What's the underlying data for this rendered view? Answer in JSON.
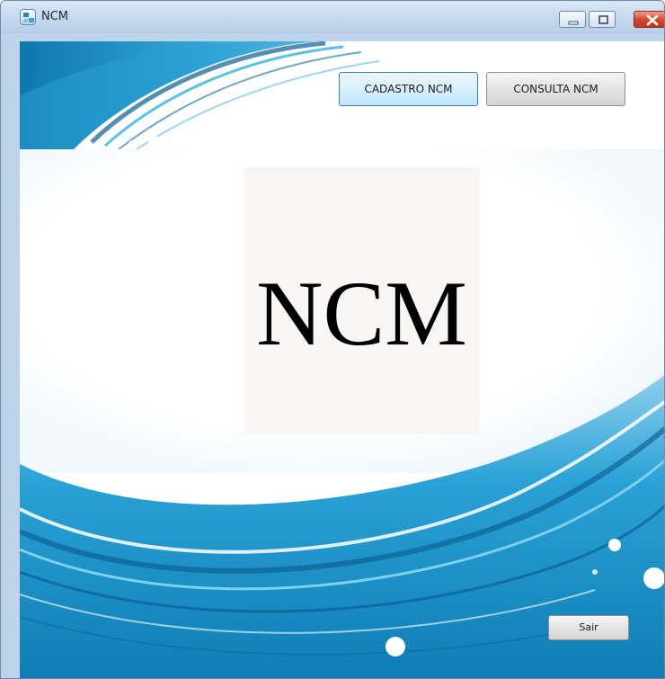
{
  "window": {
    "title": "NCM",
    "controls": {
      "minimize": "minimize-icon",
      "maximize": "maximize-icon",
      "close": "close-icon"
    }
  },
  "toolbar": {
    "cadastro_label": "CADASTRO NCM",
    "consulta_label": "CONSULTA NCM"
  },
  "main": {
    "logo_text": "NCM"
  },
  "footer": {
    "exit_label": "Sair"
  },
  "colors": {
    "accent": "#1a9ed4",
    "background_blue": "#32a9d6",
    "deep_blue": "#0a5c8c",
    "logo_panel": "#f8f5f5"
  }
}
